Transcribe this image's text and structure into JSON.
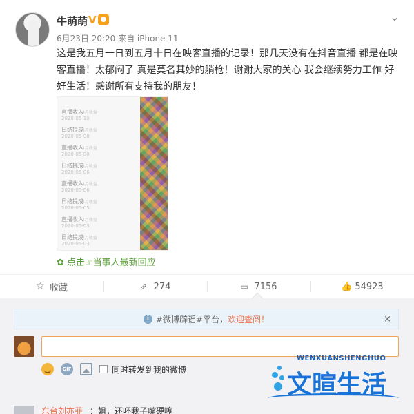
{
  "post": {
    "username": "牛萌萌",
    "vip_badge": "V",
    "meta": "6月23日 20:20 来自 iPhone 11",
    "content": "这是我五月一日到五月十日在映客直播的记录！那几天没有在抖音直播 都是在映客直播！太郁闷了 真是莫名其妙的躺枪！谢谢大家的关心 我会继续努力工作 好好生活！感谢所有支持我的朋友！",
    "reply_link": "点击☞当事人最新回应",
    "image_rows": [
      {
        "label": "直播收入",
        "tag": "4月收益",
        "date": "2020-05-10"
      },
      {
        "label": "日结提成",
        "tag": "4月收益",
        "date": "2020-05-08"
      },
      {
        "label": "直播收入",
        "tag": "4月收益",
        "date": "2020-05-08"
      },
      {
        "label": "日结提成",
        "tag": "4月收益",
        "date": "2020-05-06"
      },
      {
        "label": "直播收入",
        "tag": "4月收益",
        "date": "2020-05-06"
      },
      {
        "label": "日结提成",
        "tag": "4月收益",
        "date": "2020-05-05"
      },
      {
        "label": "直播收入",
        "tag": "4月收益",
        "date": "2020-05-03"
      },
      {
        "label": "日结提成",
        "tag": "4月收益",
        "date": "2020-05-03"
      }
    ]
  },
  "actions": {
    "favorite": "收藏",
    "repost": "274",
    "comment": "7156",
    "like": "54923"
  },
  "comments": {
    "notice_tag": "#微博辟谣#平台，",
    "notice_link": "欢迎查阅！",
    "close": "×",
    "gif": "GIF",
    "also_repost": "同时转发到我的微博",
    "first_commenter": "东台刘亦菲",
    "first_comment": "：姐，还呸我子嘴硬噻"
  },
  "watermark": {
    "en": "WENXUANSHENGHUO",
    "cn": "文暄生活"
  },
  "colors": {
    "accent_orange": "#eb7350",
    "link_green": "#5a9f3a",
    "brand_blue": "#1a73d6"
  }
}
